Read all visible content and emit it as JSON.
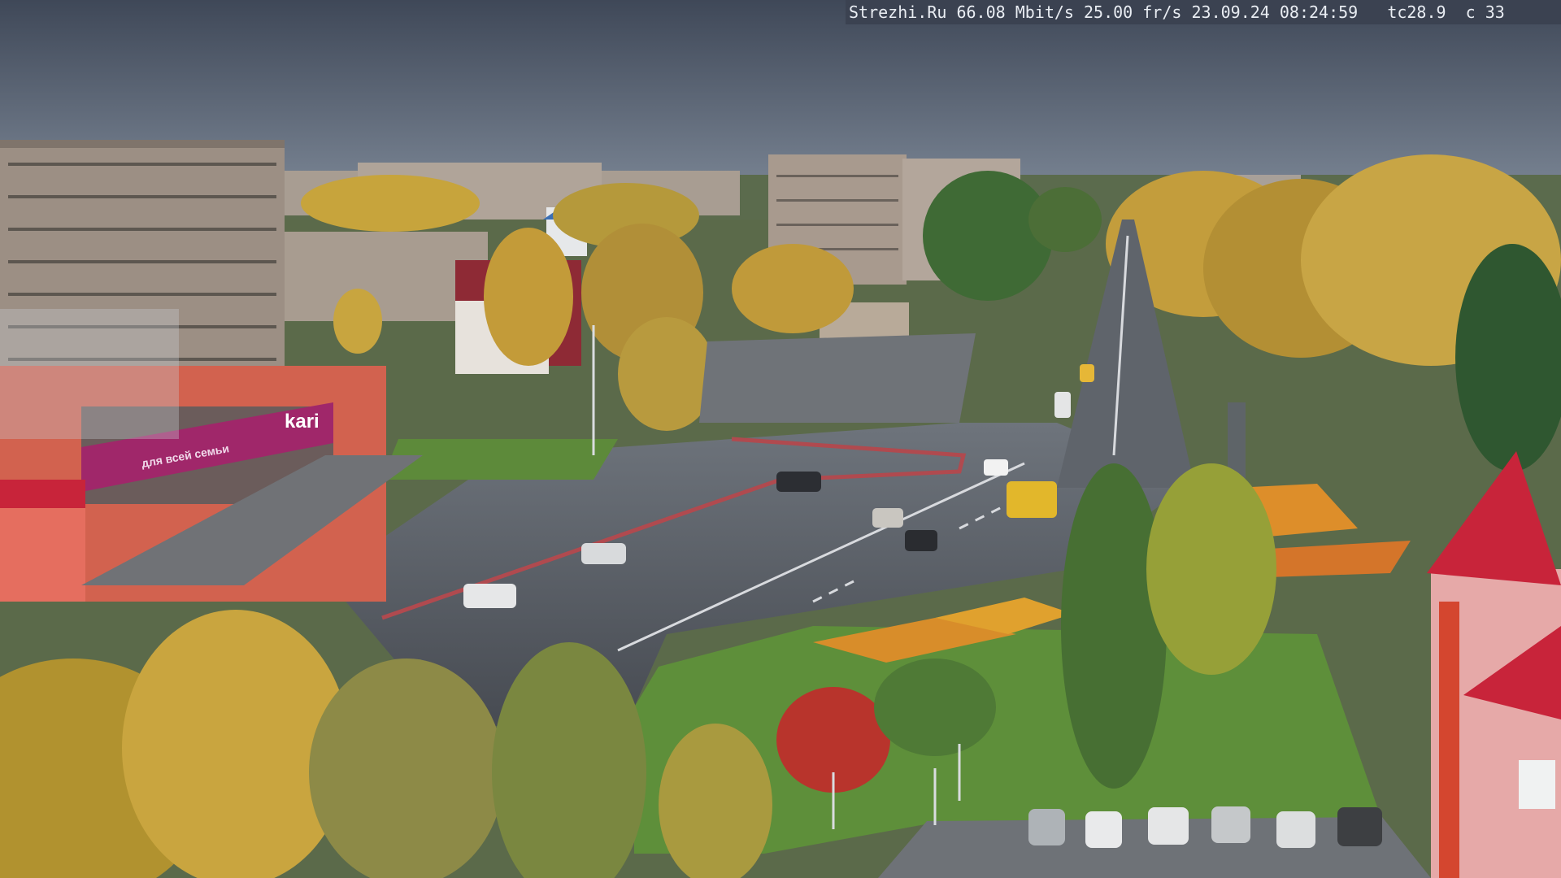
{
  "overlay": {
    "site": "Strezhi.Ru",
    "bitrate": "66.08 Mbit/s",
    "framerate": "25.00 fr/s",
    "date": "23.09.24",
    "time": "08:24:59",
    "temperature": "tc28.9",
    "counter": "c 33"
  },
  "signs": {
    "store_brand": "kari",
    "store_slogan": "для всей семьи"
  },
  "colors": {
    "sky": "#4a5362",
    "road": "#4d5158",
    "grass": "#5d8a3a",
    "foliage_yellow": "#c9a43a",
    "store_magenta": "#a0276a",
    "roof_red": "#c8243a"
  }
}
